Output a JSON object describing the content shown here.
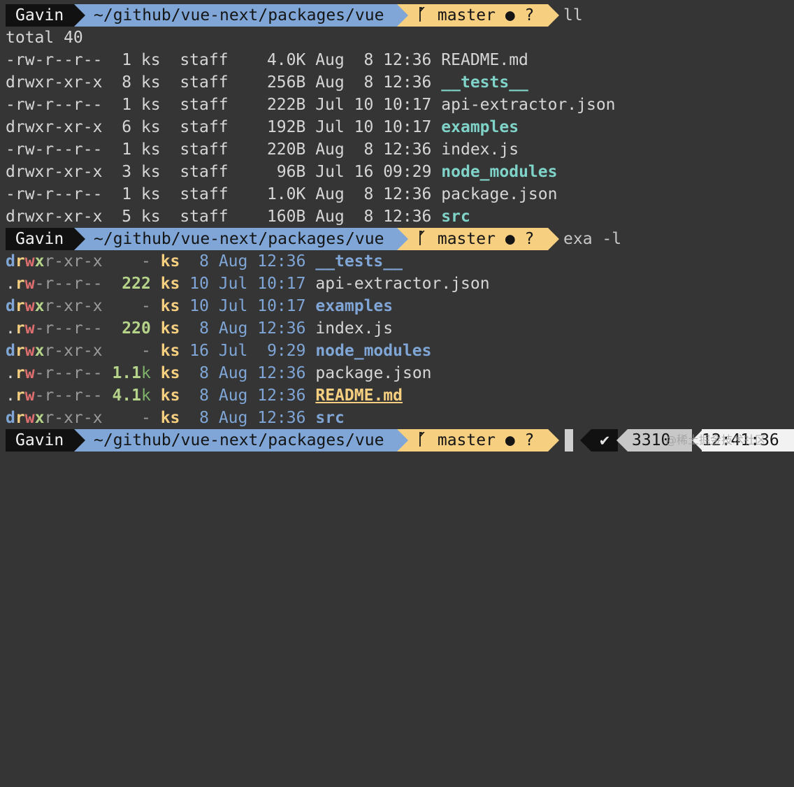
{
  "prompt": {
    "user": "Gavin",
    "path": "~/github/vue-next/packages/vue",
    "branch_icon": "ᚵ",
    "branch": "master",
    "branch_status": "● ?"
  },
  "commands": [
    "ll",
    "exa -l"
  ],
  "ll": {
    "total": "total 40",
    "rows": [
      {
        "perm": "-rw-r--r--",
        "links": "1",
        "user": "ks",
        "group": "staff",
        "size": "4.0K",
        "month": "Aug",
        "day": "8",
        "time": "12:36",
        "name": "README.md",
        "type": "file"
      },
      {
        "perm": "drwxr-xr-x",
        "links": "8",
        "user": "ks",
        "group": "staff",
        "size": "256B",
        "month": "Aug",
        "day": "8",
        "time": "12:36",
        "name": "__tests__",
        "type": "dir"
      },
      {
        "perm": "-rw-r--r--",
        "links": "1",
        "user": "ks",
        "group": "staff",
        "size": "222B",
        "month": "Jul",
        "day": "10",
        "time": "10:17",
        "name": "api-extractor.json",
        "type": "file"
      },
      {
        "perm": "drwxr-xr-x",
        "links": "6",
        "user": "ks",
        "group": "staff",
        "size": "192B",
        "month": "Jul",
        "day": "10",
        "time": "10:17",
        "name": "examples",
        "type": "dir"
      },
      {
        "perm": "-rw-r--r--",
        "links": "1",
        "user": "ks",
        "group": "staff",
        "size": "220B",
        "month": "Aug",
        "day": "8",
        "time": "12:36",
        "name": "index.js",
        "type": "file"
      },
      {
        "perm": "drwxr-xr-x",
        "links": "3",
        "user": "ks",
        "group": "staff",
        "size": "96B",
        "month": "Jul",
        "day": "16",
        "time": "09:29",
        "name": "node_modules",
        "type": "dir"
      },
      {
        "perm": "-rw-r--r--",
        "links": "1",
        "user": "ks",
        "group": "staff",
        "size": "1.0K",
        "month": "Aug",
        "day": "8",
        "time": "12:36",
        "name": "package.json",
        "type": "file"
      },
      {
        "perm": "drwxr-xr-x",
        "links": "5",
        "user": "ks",
        "group": "staff",
        "size": "160B",
        "month": "Aug",
        "day": "8",
        "time": "12:36",
        "name": "src",
        "type": "dir"
      }
    ]
  },
  "exa": {
    "rows": [
      {
        "perm": "drwxr-xr-x",
        "size_num": "-",
        "size_unit": "",
        "user": "ks",
        "day": "8",
        "month": "Aug",
        "time": "12:36",
        "name": "__tests__",
        "type": "dir"
      },
      {
        "perm": ".rw-r--r--",
        "size_num": "222",
        "size_unit": "",
        "user": "ks",
        "day": "10",
        "month": "Jul",
        "time": "10:17",
        "name": "api-extractor.json",
        "type": "file"
      },
      {
        "perm": "drwxr-xr-x",
        "size_num": "-",
        "size_unit": "",
        "user": "ks",
        "day": "10",
        "month": "Jul",
        "time": "10:17",
        "name": "examples",
        "type": "dir"
      },
      {
        "perm": ".rw-r--r--",
        "size_num": "220",
        "size_unit": "",
        "user": "ks",
        "day": "8",
        "month": "Aug",
        "time": "12:36",
        "name": "index.js",
        "type": "file"
      },
      {
        "perm": "drwxr-xr-x",
        "size_num": "-",
        "size_unit": "",
        "user": "ks",
        "day": "16",
        "month": "Jul",
        "time": "9:29",
        "name": "node_modules",
        "type": "dir"
      },
      {
        "perm": ".rw-r--r--",
        "size_num": "1.1",
        "size_unit": "k",
        "user": "ks",
        "day": "8",
        "month": "Aug",
        "time": "12:36",
        "name": "package.json",
        "type": "file"
      },
      {
        "perm": ".rw-r--r--",
        "size_num": "4.1",
        "size_unit": "k",
        "user": "ks",
        "day": "8",
        "month": "Aug",
        "time": "12:36",
        "name": "README.md",
        "type": "readme"
      },
      {
        "perm": "drwxr-xr-x",
        "size_num": "-",
        "size_unit": "",
        "user": "ks",
        "day": "8",
        "month": "Aug",
        "time": "12:36",
        "name": "src",
        "type": "dir"
      }
    ]
  },
  "right_prompt": {
    "status_icon": "✔",
    "count": "3310",
    "time": "12:41:36"
  },
  "watermark": "@稀土掘金技术社区",
  "colors": {
    "background": "#353535",
    "path_segment": "#7fa6d6",
    "git_segment": "#f6cf80",
    "dir": "#7fd3c8"
  }
}
